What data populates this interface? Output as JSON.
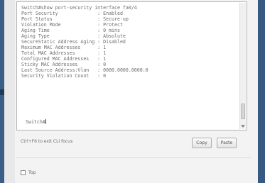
{
  "console": {
    "lines": [
      "Switch#show port-security interface fa0/4",
      "Port Security              : Enabled",
      "Port Status                : Secure-up",
      "Violation Mode             : Protect",
      "Aging Time                 : 0 mins",
      "Aging Type                 : Absolute",
      "SecureStatic Address Aging : Disabled",
      "Maximum MAC Addresses      : 1",
      "Total MAC Addresses        : 1",
      "Configured MAC Addresses   : 1",
      "Sticky MAC Addresses       : 0",
      "Last Source Address:Vlan   : 0000.0000.0000:0",
      "Security Violation Count   : 0"
    ],
    "prompt": "Switch#"
  },
  "footer": {
    "hint": "Ctrl+F6 to exit CLI focus",
    "copy_label": "Copy",
    "paste_label": "Paste"
  },
  "options": {
    "top_label": "Top",
    "top_checked": false
  }
}
